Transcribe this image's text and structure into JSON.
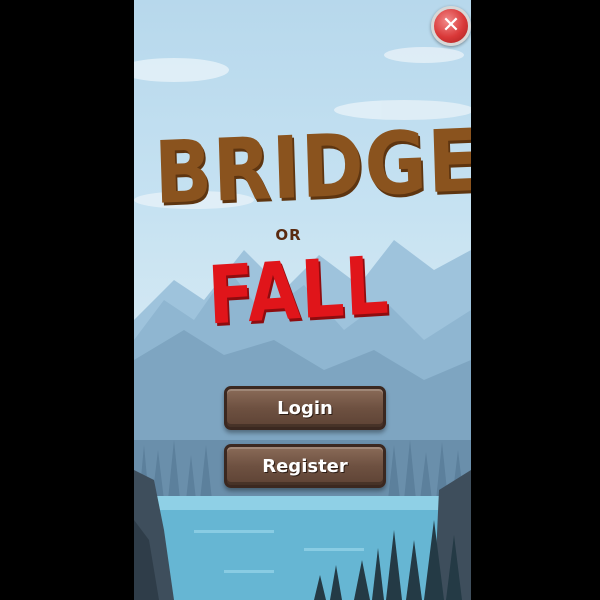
{
  "title": {
    "line1": "BRIDGE",
    "connector": "OR",
    "line2": "FALL"
  },
  "buttons": {
    "login_label": "Login",
    "register_label": "Register"
  },
  "icons": {
    "close": "close-icon"
  },
  "colors": {
    "title_bridge": "#8a531e",
    "title_fall": "#e0151a",
    "sky": "#c6e2f2",
    "lake": "#66b6d3",
    "button_wood": "#6e5141",
    "close_button": "#d93838"
  }
}
